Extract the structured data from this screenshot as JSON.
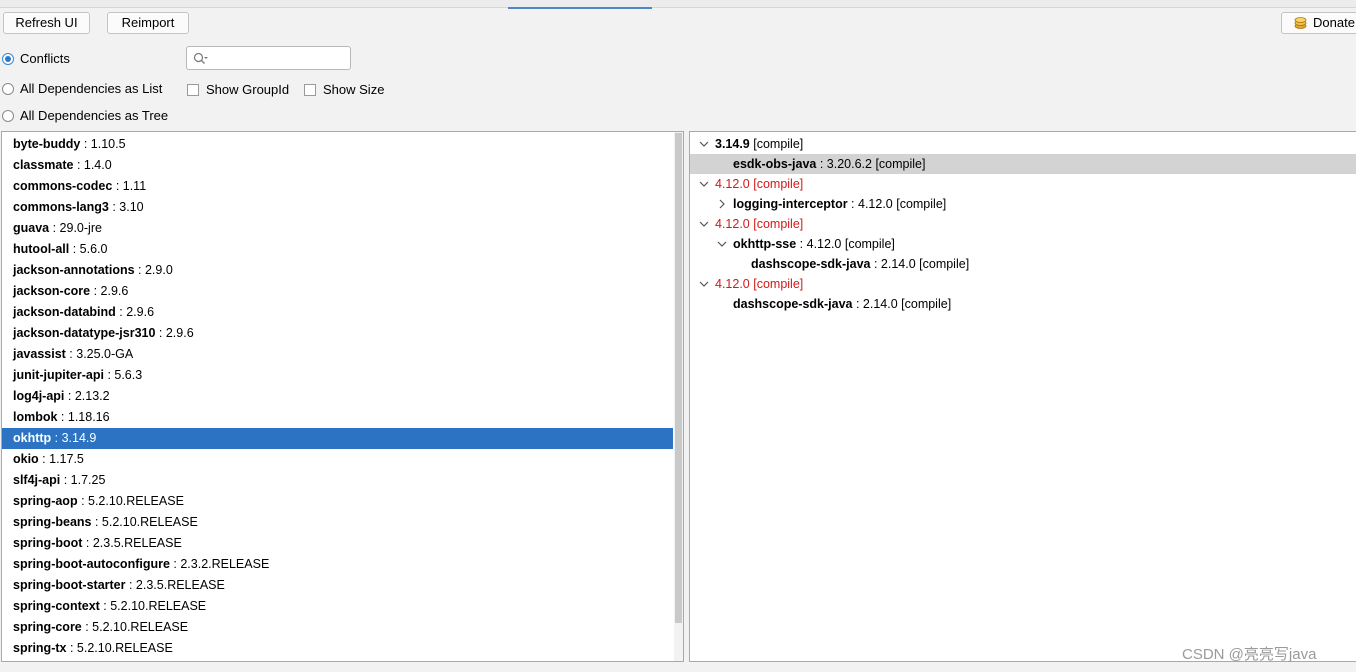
{
  "toolbar": {
    "refresh_label": "Refresh UI",
    "reimport_label": "Reimport",
    "donate_label": "Donate"
  },
  "options": {
    "conflicts_label": "Conflicts",
    "list_label": "All Dependencies as List",
    "tree_label": "All Dependencies as Tree",
    "show_groupid_label": "Show GroupId",
    "show_size_label": "Show Size",
    "selected_mode": "Conflicts"
  },
  "search": {
    "value": "",
    "placeholder": ""
  },
  "dependencies": [
    {
      "name": "byte-buddy",
      "version": " : 1.10.5"
    },
    {
      "name": "classmate",
      "version": " : 1.4.0"
    },
    {
      "name": "commons-codec",
      "version": " : 1.11"
    },
    {
      "name": "commons-lang3",
      "version": " : 3.10"
    },
    {
      "name": "guava",
      "version": " : 29.0-jre"
    },
    {
      "name": "hutool-all",
      "version": " : 5.6.0"
    },
    {
      "name": "jackson-annotations",
      "version": " : 2.9.0"
    },
    {
      "name": "jackson-core",
      "version": " : 2.9.6"
    },
    {
      "name": "jackson-databind",
      "version": " : 2.9.6"
    },
    {
      "name": "jackson-datatype-jsr310",
      "version": " : 2.9.6"
    },
    {
      "name": "javassist",
      "version": " : 3.25.0-GA"
    },
    {
      "name": "junit-jupiter-api",
      "version": " : 5.6.3"
    },
    {
      "name": "log4j-api",
      "version": " : 2.13.2"
    },
    {
      "name": "lombok",
      "version": " : 1.18.16"
    },
    {
      "name": "okhttp",
      "version": " : 3.14.9",
      "selected": true
    },
    {
      "name": "okio",
      "version": " : 1.17.5"
    },
    {
      "name": "slf4j-api",
      "version": " : 1.7.25"
    },
    {
      "name": "spring-aop",
      "version": " : 5.2.10.RELEASE"
    },
    {
      "name": "spring-beans",
      "version": " : 5.2.10.RELEASE"
    },
    {
      "name": "spring-boot",
      "version": " : 2.3.5.RELEASE"
    },
    {
      "name": "spring-boot-autoconfigure",
      "version": " : 2.3.2.RELEASE"
    },
    {
      "name": "spring-boot-starter",
      "version": " : 2.3.5.RELEASE"
    },
    {
      "name": "spring-context",
      "version": " : 5.2.10.RELEASE"
    },
    {
      "name": "spring-core",
      "version": " : 5.2.10.RELEASE"
    },
    {
      "name": "spring-tx",
      "version": " : 5.2.10.RELEASE"
    }
  ],
  "tree": [
    {
      "level": 0,
      "toggle": "expanded",
      "bold": "3.14.9",
      "rest": " [compile]",
      "red": false
    },
    {
      "level": 1,
      "toggle": "none",
      "bold": "esdk-obs-java",
      "rest": " : 3.20.6.2 [compile]",
      "highlight": true
    },
    {
      "level": 0,
      "toggle": "expanded",
      "bold": "",
      "rest": "4.12.0 [compile]",
      "red": true
    },
    {
      "level": 1,
      "toggle": "collapsed",
      "bold": "logging-interceptor",
      "rest": " : 4.12.0 [compile]"
    },
    {
      "level": 0,
      "toggle": "expanded",
      "bold": "",
      "rest": "4.12.0 [compile]",
      "red": true
    },
    {
      "level": 1,
      "toggle": "expanded",
      "bold": "okhttp-sse",
      "rest": " : 4.12.0 [compile]"
    },
    {
      "level": 2,
      "toggle": "none",
      "bold": "dashscope-sdk-java",
      "rest": " : 2.14.0 [compile]"
    },
    {
      "level": 0,
      "toggle": "expanded",
      "bold": "",
      "rest": "4.12.0 [compile]",
      "red": true
    },
    {
      "level": 1,
      "toggle": "none",
      "bold": "dashscope-sdk-java",
      "rest": " : 2.14.0 [compile]"
    }
  ],
  "watermark": "CSDN @亮亮写java",
  "colors": {
    "selection": "#2c74c3",
    "conflict_red": "#d11a1a",
    "accent": "#2b79c8"
  }
}
